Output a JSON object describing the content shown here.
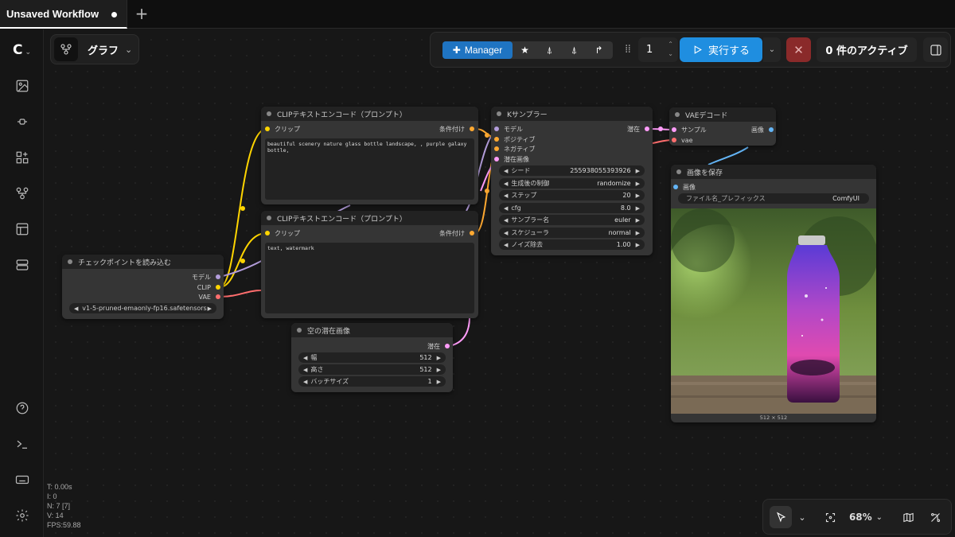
{
  "tab": {
    "title": "Unsaved Workflow",
    "add": "+"
  },
  "graph": {
    "label": "グラフ"
  },
  "toolbar": {
    "manager_label": "Manager",
    "queue_count": "1",
    "run_label": "実行する",
    "active_label": "0 件のアクティブ"
  },
  "nodes": {
    "clip_pos": {
      "title": "CLIPテキストエンコード（プロンプト）",
      "input": "クリップ",
      "output": "条件付け",
      "text": "beautiful scenery nature glass bottle landscape, , purple galaxy bottle,"
    },
    "clip_neg": {
      "title": "CLIPテキストエンコード（プロンプト）",
      "input": "クリップ",
      "output": "条件付け",
      "text": "text, watermark"
    },
    "ksampler": {
      "title": "Kサンプラー",
      "inputs": [
        "モデル",
        "ポジティブ",
        "ネガティブ",
        "潜在画像"
      ],
      "output": "潜在",
      "widgets": [
        {
          "label": "シード",
          "value": "255938055393926"
        },
        {
          "label": "生成後の制御",
          "value": "randomize"
        },
        {
          "label": "ステップ",
          "value": "20"
        },
        {
          "label": "cfg",
          "value": "8.0"
        },
        {
          "label": "サンプラー名",
          "value": "euler"
        },
        {
          "label": "スケジューラ",
          "value": "normal"
        },
        {
          "label": "ノイズ除去",
          "value": "1.00"
        }
      ]
    },
    "vae_decode": {
      "title": "VAEデコード",
      "inputs": [
        "サンプル",
        "vae"
      ],
      "output": "画像"
    },
    "save_image": {
      "title": "画像を保存",
      "input": "画像",
      "prefix_label": "ファイル名_プレフィックス",
      "prefix_value": "ComfyUI",
      "size_label": "512 × 512"
    },
    "checkpoint": {
      "title": "チェックポイントを読み込む",
      "outputs": [
        "モデル",
        "CLIP",
        "VAE"
      ],
      "ckpt": "v1-5-pruned-emaonly-fp16.safetensors"
    },
    "empty_latent": {
      "title": "空の潜在画像",
      "output": "潜在",
      "widgets": [
        {
          "label": "幅",
          "value": "512"
        },
        {
          "label": "高さ",
          "value": "512"
        },
        {
          "label": "バッチサイズ",
          "value": "1"
        }
      ]
    }
  },
  "stats": {
    "t": "T: 0.00s",
    "i": "I: 0",
    "n": "N: 7 [7]",
    "v": "V: 14",
    "fps": "FPS:59.88"
  },
  "zoom": {
    "label": "68%"
  },
  "colors": {
    "model": "#b39ddb",
    "clip": "#ffd500",
    "vae": "#ff6e6e",
    "conditioning": "#ffa931",
    "latent": "#ff9cf9",
    "image": "#64b5f6",
    "accent": "#1f8ee0"
  }
}
